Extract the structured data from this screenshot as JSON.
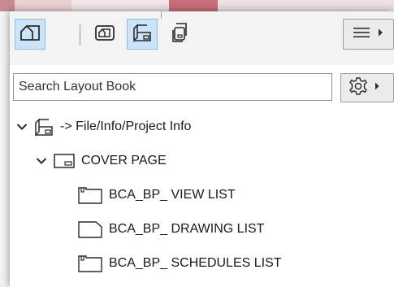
{
  "toolbar": {
    "buttons": [
      {
        "icon": "project-map-icon",
        "active": true
      },
      {
        "icon": "view-map-icon",
        "active": false
      },
      {
        "icon": "layout-book-icon",
        "active": true
      },
      {
        "icon": "publisher-sets-icon",
        "active": false
      }
    ],
    "menu_icon": "hamburger-menu-icon"
  },
  "search": {
    "placeholder": "Search Layout Book"
  },
  "settings_icon": "gear-icon",
  "tree": {
    "root": {
      "label": "-> File/Info/Project Info",
      "icon": "layout-book-icon",
      "expanded": true
    },
    "subset": {
      "label": "COVER PAGE",
      "icon": "subset-icon",
      "expanded": true
    },
    "layouts": [
      {
        "label": "BCA_BP_ VIEW LIST",
        "icon": "layout-icon"
      },
      {
        "label": "BCA_BP_ DRAWING LIST",
        "icon": "layout-plain-icon"
      },
      {
        "label": "BCA_BP_ SCHEDULES LIST",
        "icon": "layout-icon"
      }
    ]
  },
  "colors": {
    "active_button_bg": "#cde3f7",
    "active_button_border": "#8fbce6",
    "panel_bg": "#ffffff",
    "toolbar_bg": "#f3f3f3"
  }
}
